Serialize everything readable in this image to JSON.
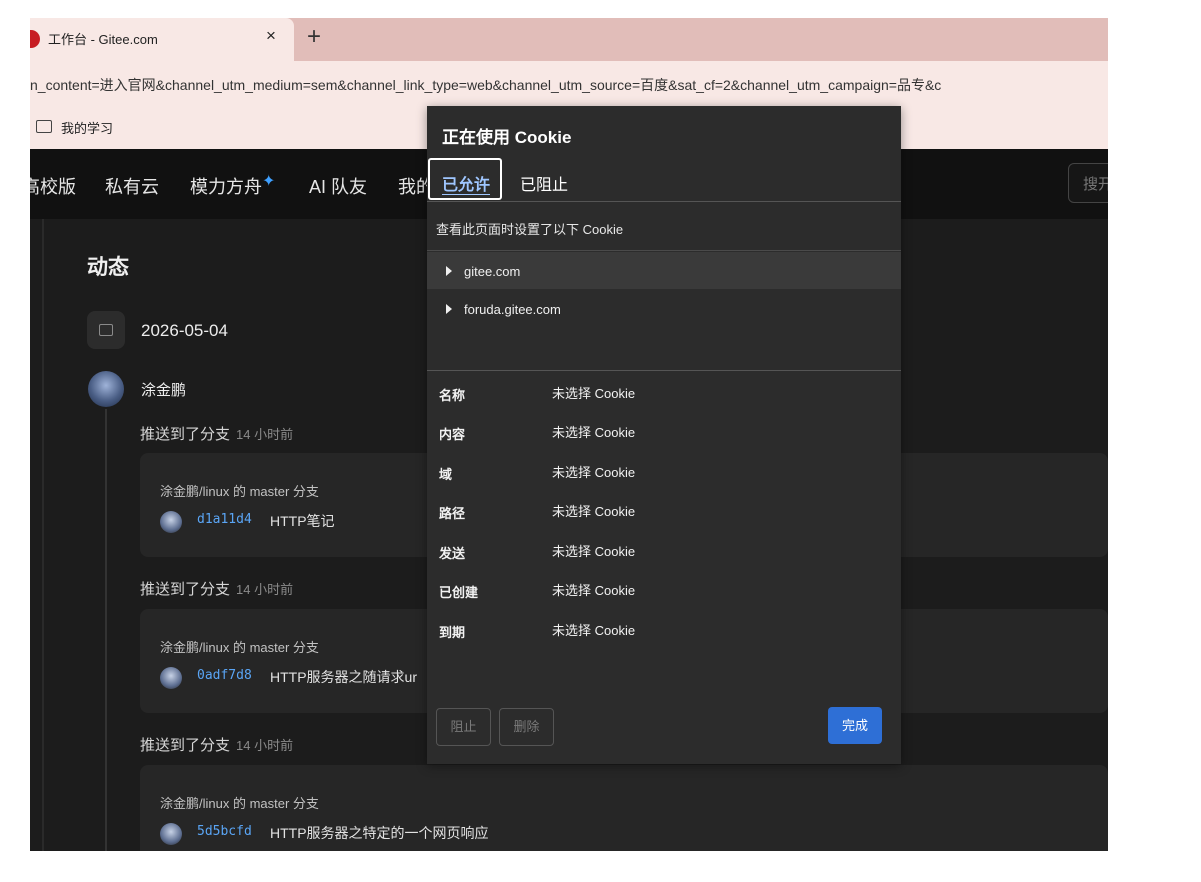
{
  "browser": {
    "tab_title": "工作台 - Gitee.com",
    "tab_close": "×",
    "new_tab": "+",
    "url": "n_content=进入官网&channel_utm_medium=sem&channel_link_type=web&channel_utm_source=百度&sat_cf=2&channel_utm_campaign=品专&c",
    "bookmark": "我的学习"
  },
  "nav": {
    "items": [
      "高校版",
      "私有云",
      "模力方舟",
      "AI 队友",
      "我的"
    ],
    "sparkle": "✦",
    "search_placeholder": "搜开"
  },
  "feed": {
    "title": "动态",
    "date": "2026-05-04",
    "user": "涂金鹏",
    "pushes": [
      {
        "action": "推送到了分支",
        "time": "14 小时前",
        "branch": "涂金鹏/linux 的 master 分支",
        "hash": "d1a11d4",
        "message": "HTTP笔记"
      },
      {
        "action": "推送到了分支",
        "time": "14 小时前",
        "branch": "涂金鹏/linux 的 master 分支",
        "hash": "0adf7d8",
        "message": "HTTP服务器之随请求ur"
      },
      {
        "action": "推送到了分支",
        "time": "14 小时前",
        "branch": "涂金鹏/linux 的 master 分支",
        "hash": "5d5bcfd",
        "message": "HTTP服务器之特定的一个网页响应"
      }
    ]
  },
  "cookie_dialog": {
    "title": "正在使用 Cookie",
    "tab_allowed": "已允许",
    "tab_blocked": "已阻止",
    "description": "查看此页面时设置了以下 Cookie",
    "sites": [
      "gitee.com",
      "foruda.gitee.com"
    ],
    "properties": [
      {
        "label": "名称",
        "value": "未选择 Cookie"
      },
      {
        "label": "内容",
        "value": "未选择 Cookie"
      },
      {
        "label": "域",
        "value": "未选择 Cookie"
      },
      {
        "label": "路径",
        "value": "未选择 Cookie"
      },
      {
        "label": "发送",
        "value": "未选择 Cookie"
      },
      {
        "label": "已创建",
        "value": "未选择 Cookie"
      },
      {
        "label": "到期",
        "value": "未选择 Cookie"
      }
    ],
    "btn_block": "阻止",
    "btn_delete": "删除",
    "btn_done": "完成"
  },
  "colors": {
    "accent": "#2e6fd6",
    "hash_link": "#5aa5f5",
    "tab_bar": "#e1bdb9",
    "page_bg": "#1c1c1c"
  }
}
